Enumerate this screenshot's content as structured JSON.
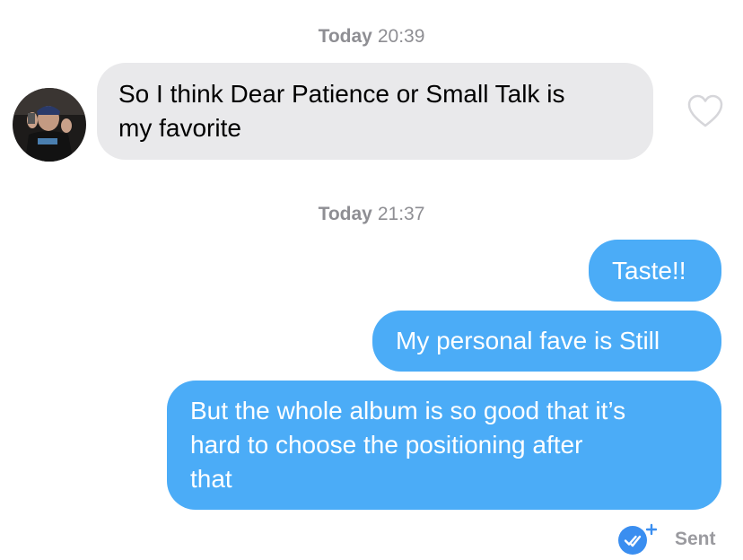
{
  "conversation": {
    "timestamps": [
      {
        "day": "Today",
        "time": "20:39"
      },
      {
        "day": "Today",
        "time": "21:37"
      }
    ],
    "incoming_messages": [
      {
        "text": "So I think Dear Patience or Small Talk is\nmy favorite",
        "liked": false
      }
    ],
    "outgoing_messages": [
      {
        "text": "Taste!!"
      },
      {
        "text": "My personal fave is Still"
      },
      {
        "text": "But the whole album is so good that it’s\nhard to choose the positioning after\nthat"
      }
    ],
    "status": {
      "label": "Sent",
      "icon": "read-receipt-check-icon"
    }
  },
  "colors": {
    "outgoing_bubble": "#4bacf7",
    "incoming_bubble": "#e9e9eb",
    "timestamp_text": "#8e8e93",
    "receipt_badge": "#3a8ef0"
  },
  "icons": {
    "like": "heart-icon",
    "avatar": "contact-avatar"
  }
}
